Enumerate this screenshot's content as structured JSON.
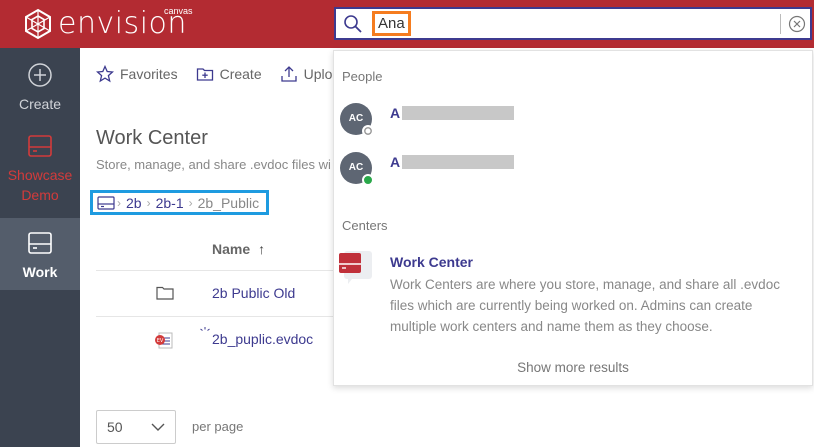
{
  "app": {
    "logo_text": "envision",
    "logo_superscript": "canvas"
  },
  "search": {
    "value": "Ana"
  },
  "sidebar": {
    "items": [
      {
        "label": "Create"
      },
      {
        "label": "Showcase Demo"
      },
      {
        "label": "Work"
      }
    ]
  },
  "toolbar": {
    "favorites": "Favorites",
    "create": "Create",
    "upload": "Uploa"
  },
  "page": {
    "title": "Work Center",
    "description": "Store, manage, and share .evdoc files wi"
  },
  "breadcrumb": {
    "items": [
      "2b",
      "2b-1",
      "2b_Public"
    ]
  },
  "table": {
    "column_name": "Name",
    "sort_arrow": "↑",
    "rows": [
      {
        "name": "2b Public Old",
        "type": "folder"
      },
      {
        "name": "2b_puplic.evdoc",
        "type": "evdoc"
      }
    ]
  },
  "pagination": {
    "per_page_value": "50",
    "per_page_label": "per page"
  },
  "dropdown": {
    "people_header": "People",
    "people": [
      {
        "initials": "AC",
        "name_visible": "A",
        "status": "offline"
      },
      {
        "initials": "AC",
        "name_visible": "A",
        "status": "online"
      }
    ],
    "centers_header": "Centers",
    "center": {
      "title": "Work Center",
      "description": "Work Centers are where you store, manage, and share all .evdoc files which are currently being worked on. Admins can create multiple work centers and name them as they choose."
    },
    "show_more": "Show more results"
  },
  "colors": {
    "brand_red": "#b32b32",
    "accent_indigo": "#3d3a8f",
    "highlight_orange": "#f57c1f",
    "highlight_blue": "#1e9be0",
    "sidebar_bg": "#3b4350",
    "online_green": "#2aa84a"
  }
}
